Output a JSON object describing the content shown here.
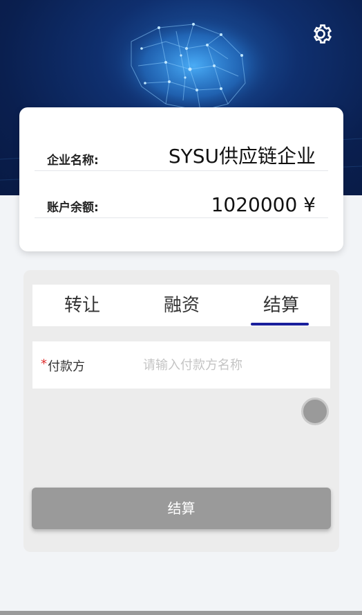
{
  "header": {
    "settings_icon": "gear-icon",
    "banner_theme_color": "#0f2f6e"
  },
  "account": {
    "company_label": "企业名称:",
    "company_name": "SYSU供应链企业",
    "balance_label": "账户余额:",
    "balance_value": "1020000 ¥"
  },
  "tabs": [
    {
      "label": "转让",
      "active": false
    },
    {
      "label": "融资",
      "active": false
    },
    {
      "label": "结算",
      "active": true
    }
  ],
  "form": {
    "required_mark": "*",
    "payer_label": "付款方",
    "payer_placeholder": "请输入付款方名称",
    "payer_value": "",
    "submit_label": "结算"
  },
  "colors": {
    "tab_active_underline": "#1a1f9c",
    "required": "#e03030",
    "button": "#9a9a9a"
  }
}
